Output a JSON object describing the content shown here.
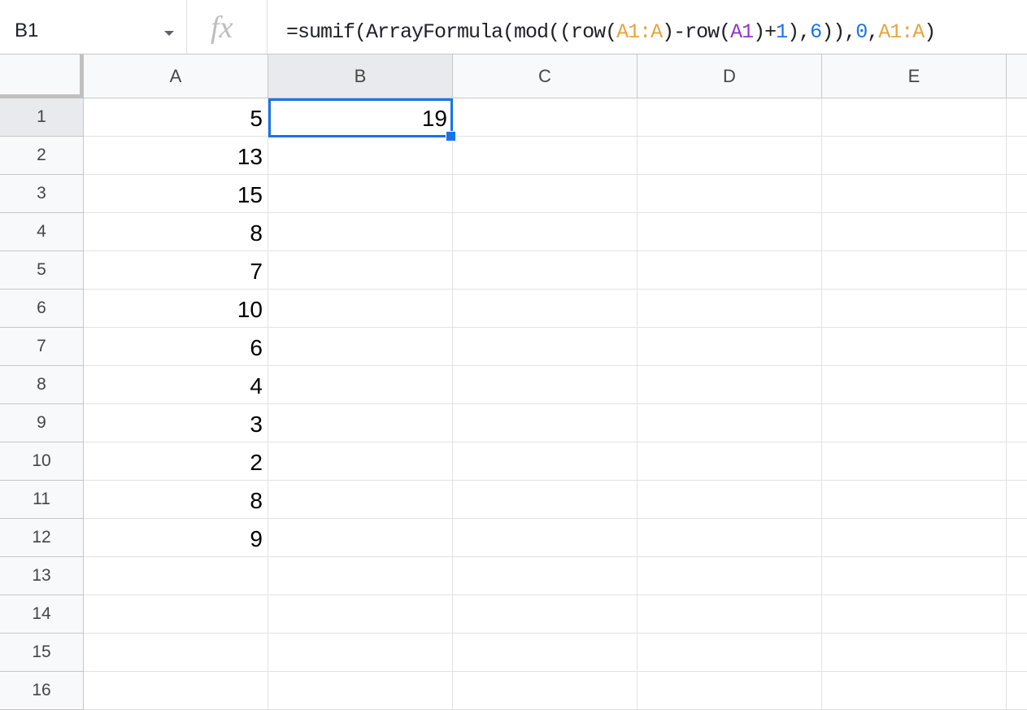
{
  "name_box": {
    "value": "B1"
  },
  "formula_bar": {
    "fx_label": "fx",
    "formula_parts": [
      {
        "text": "=sumif(ArrayFormula(mod((row(",
        "color": "#202124"
      },
      {
        "text": "A1:A",
        "color": "#e8a33d"
      },
      {
        "text": ")-row(",
        "color": "#202124"
      },
      {
        "text": "A1",
        "color": "#9334c6"
      },
      {
        "text": ")+",
        "color": "#202124"
      },
      {
        "text": "1",
        "color": "#1a73e8"
      },
      {
        "text": "),",
        "color": "#202124"
      },
      {
        "text": "6",
        "color": "#1a73e8"
      },
      {
        "text": ")),",
        "color": "#202124"
      },
      {
        "text": "0",
        "color": "#1a73e8"
      },
      {
        "text": ",",
        "color": "#202124"
      },
      {
        "text": "A1:A",
        "color": "#e8a33d"
      },
      {
        "text": ")",
        "color": "#202124"
      }
    ]
  },
  "columns": [
    "A",
    "B",
    "C",
    "D",
    "E"
  ],
  "rows": [
    "1",
    "2",
    "3",
    "4",
    "5",
    "6",
    "7",
    "8",
    "9",
    "10",
    "11",
    "12",
    "13",
    "14",
    "15",
    "16"
  ],
  "selected": {
    "column": "B",
    "row": "1"
  },
  "cells": {
    "A": [
      "5",
      "13",
      "15",
      "8",
      "7",
      "10",
      "6",
      "4",
      "3",
      "2",
      "8",
      "9",
      "",
      "",
      "",
      ""
    ],
    "B": [
      "19",
      "",
      "",
      "",
      "",
      "",
      "",
      "",
      "",
      "",
      "",
      "",
      "",
      "",
      "",
      ""
    ]
  }
}
